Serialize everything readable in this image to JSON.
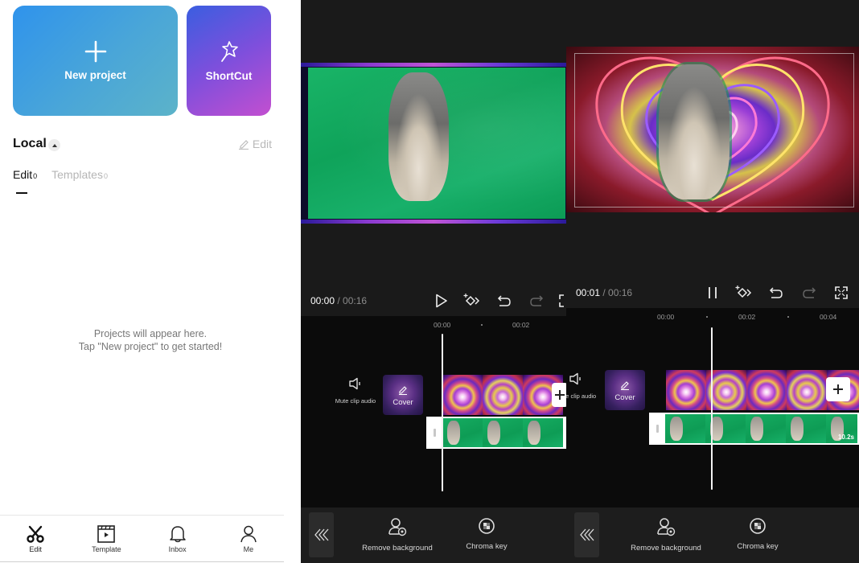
{
  "home": {
    "new_project_label": "New project",
    "shortcut_label": "ShortCut",
    "local_title": "Local",
    "edit_label": "Edit",
    "subtabs": [
      {
        "label": "Edit",
        "count": "0"
      },
      {
        "label": "Templates",
        "count": "0"
      }
    ],
    "empty_line1": "Projects will appear here.",
    "empty_line2": "Tap \"New project\" to get started!",
    "bottom_nav": [
      {
        "label": "Edit",
        "icon": "scissors-icon"
      },
      {
        "label": "Template",
        "icon": "template-icon"
      },
      {
        "label": "Inbox",
        "icon": "bell-icon"
      },
      {
        "label": "Me",
        "icon": "person-icon"
      }
    ]
  },
  "editor_before": {
    "current_time": "00:00",
    "total_time": " / 00:16",
    "ruler": [
      "00:00",
      "00:02"
    ],
    "mute_label": "Mute clip audio",
    "cover_label": "Cover",
    "tools": [
      {
        "label": "Remove background",
        "icon": "remove-background-icon"
      },
      {
        "label": "Chroma key",
        "icon": "chroma-key-icon"
      }
    ]
  },
  "editor_after": {
    "current_time": "00:01",
    "total_time": " / 00:16",
    "ruler": [
      "00:00",
      "00:02",
      "00:04"
    ],
    "mute_label": "Mute clip audio",
    "cover_label": "Cover",
    "clip_duration": "10.2s",
    "tools": [
      {
        "label": "Remove background",
        "icon": "remove-background-icon"
      },
      {
        "label": "Chroma key",
        "icon": "chroma-key-icon"
      }
    ]
  }
}
